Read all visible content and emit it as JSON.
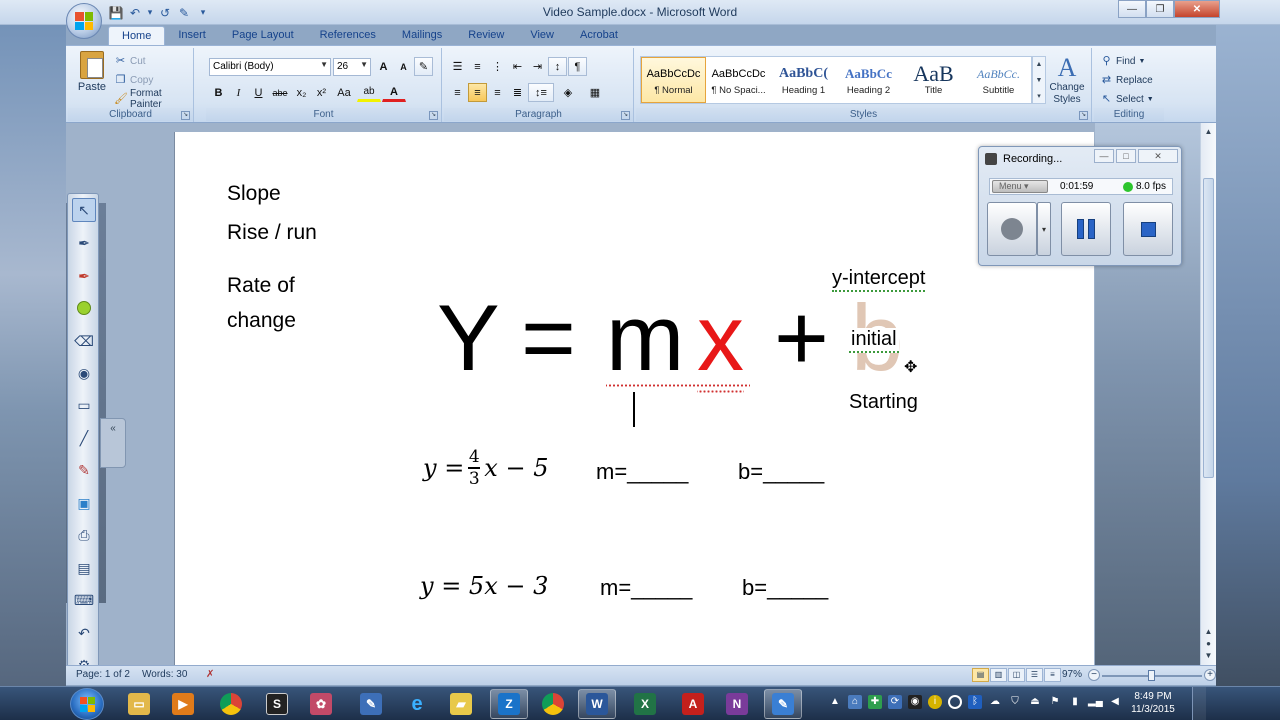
{
  "window": {
    "title": "Video Sample.docx - Microsoft Word",
    "minimize": "—",
    "restore": "❐",
    "close": "✕"
  },
  "qat": {
    "save": "💾",
    "undo": "↶",
    "undo_drop": "▾",
    "redo": "↺",
    "print": "✎",
    "more": "▾"
  },
  "ribbon": {
    "tabs": [
      "Home",
      "Insert",
      "Page Layout",
      "References",
      "Mailings",
      "Review",
      "View",
      "Acrobat"
    ],
    "clipboard": {
      "label": "Clipboard",
      "paste": "Paste",
      "cut": "Cut",
      "copy": "Copy",
      "format_painter": "Format Painter"
    },
    "font": {
      "label": "Font",
      "family": "Calibri (Body)",
      "size": "26",
      "grow": "A",
      "shrink": "A",
      "clear": "✎",
      "bold": "B",
      "italic": "I",
      "underline": "U",
      "strike": "abe",
      "subscript": "x₂",
      "superscript": "x²",
      "change_case": "Aa",
      "highlight": "ab",
      "font_color": "A"
    },
    "paragraph": {
      "label": "Paragraph",
      "show_marks": "¶",
      "sort": "↕"
    },
    "styles": {
      "label": "Styles",
      "items": [
        {
          "sample": "AaBbCcDc",
          "name": "¶ Normal"
        },
        {
          "sample": "AaBbCcDc",
          "name": "¶ No Spaci..."
        },
        {
          "sample": "AaBbC(",
          "name": "Heading 1"
        },
        {
          "sample": "AaBbCc",
          "name": "Heading 2"
        },
        {
          "sample": "AaB",
          "name": "Title"
        },
        {
          "sample": "AaBbCc.",
          "name": "Subtitle"
        }
      ],
      "change_styles_glyph": "A",
      "change_styles": "Change Styles"
    },
    "editing": {
      "label": "Editing",
      "find": "Find",
      "replace": "Replace",
      "select": "Select"
    }
  },
  "document": {
    "slope": "Slope",
    "rise_run": "Rise / run",
    "rate_of": "Rate of",
    "change": "change",
    "y_intercept": "y-intercept",
    "initial": "initial",
    "starting": "Starting",
    "equation": {
      "y": "Y",
      "equals": "=",
      "m": "m",
      "x": "x",
      "plus": "+",
      "b": "b"
    },
    "problem1": {
      "lhs": "y = ",
      "num": "4",
      "den": "3",
      "rhs": "x − 5",
      "m_blank": "m=_____",
      "b_blank": "b=_____"
    },
    "problem2": {
      "expr": "y = 5x − 3",
      "m_blank": "m=_____",
      "b_blank": "b=_____"
    }
  },
  "recorder": {
    "title": "Recording...",
    "menu": "Menu",
    "time": "0:01:59",
    "fps": "8.0 fps"
  },
  "statusbar": {
    "page": "Page: 1 of 2",
    "words": "Words: 30",
    "zoom": "97%",
    "zoom_minus": "−",
    "zoom_plus": "+"
  },
  "taskbar": {
    "time": "8:49 PM",
    "date": "11/3/2015"
  }
}
